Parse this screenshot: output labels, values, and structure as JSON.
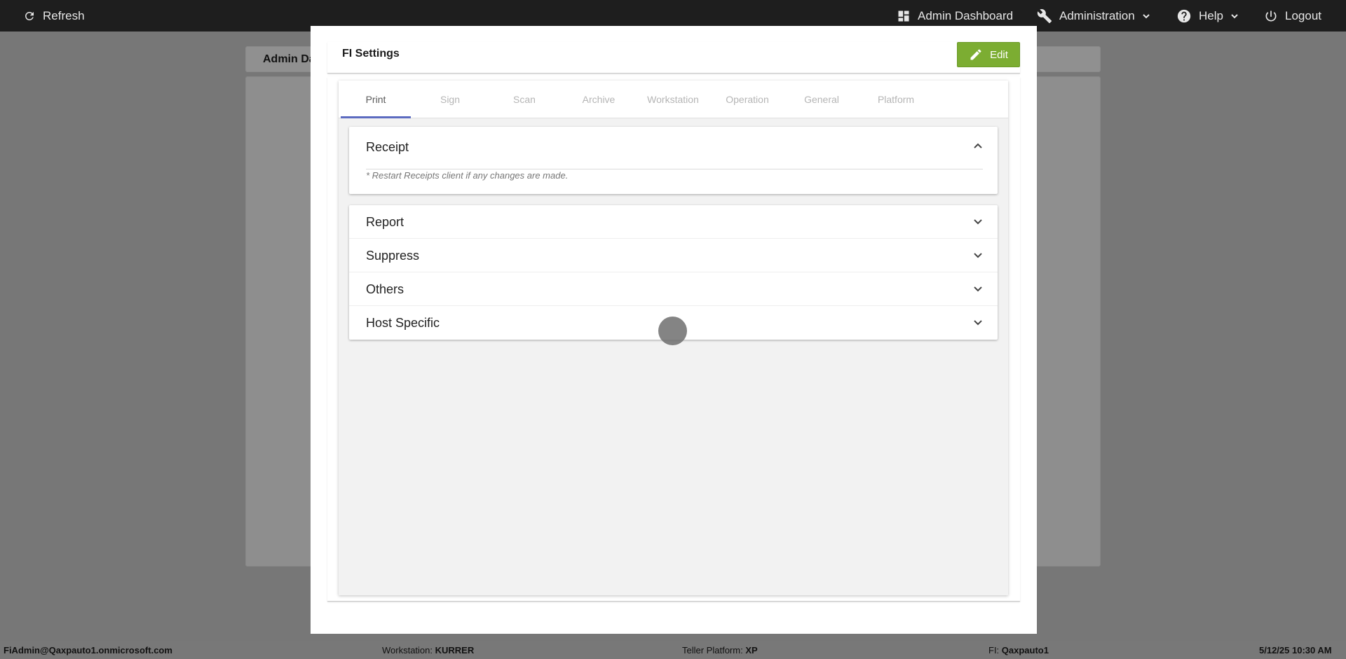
{
  "topbar": {
    "refresh_label": "Refresh",
    "admin_dashboard_label": "Admin Dashboard",
    "administration_label": "Administration",
    "help_label": "Help",
    "logout_label": "Logout"
  },
  "background": {
    "page_title": "Admin Dashboard"
  },
  "modal": {
    "title": "FI Settings",
    "edit_label": "Edit",
    "tabs": [
      {
        "label": "Print",
        "active": true
      },
      {
        "label": "Sign"
      },
      {
        "label": "Scan"
      },
      {
        "label": "Archive"
      },
      {
        "label": "Workstation"
      },
      {
        "label": "Operation"
      },
      {
        "label": "General"
      },
      {
        "label": "Platform"
      }
    ],
    "receipt": {
      "label": "Receipt",
      "note": "* Restart Receipts client if any changes are made.",
      "expanded": true
    },
    "sections": [
      {
        "label": "Report"
      },
      {
        "label": "Suppress"
      },
      {
        "label": "Others"
      },
      {
        "label": "Host Specific"
      }
    ]
  },
  "statusbar": {
    "user": "FiAdmin@Qaxpauto1.onmicrosoft.com",
    "workstation_label": "Workstation: ",
    "workstation_value": "KURRER",
    "platform_label": "Teller Platform: ",
    "platform_value": "XP",
    "fi_label": "FI: ",
    "fi_value": "Qaxpauto1",
    "datetime": "5/12/25 10:30 AM"
  },
  "colors": {
    "accent_tab": "#5c6bc0",
    "edit_button": "#7cad32",
    "topbar": "#1e1e1e"
  }
}
